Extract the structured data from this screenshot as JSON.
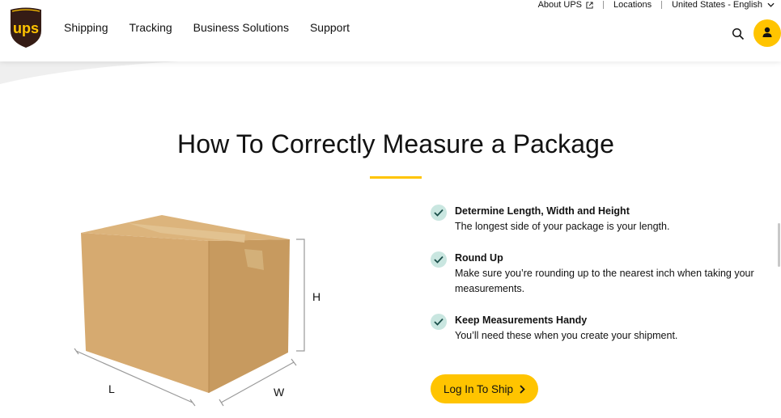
{
  "header": {
    "logo_text": "ups",
    "nav": [
      {
        "label": "Shipping"
      },
      {
        "label": "Tracking"
      },
      {
        "label": "Business Solutions"
      },
      {
        "label": "Support"
      }
    ],
    "utility": {
      "about": "About UPS",
      "locations": "Locations",
      "locale": "United States - English"
    },
    "icons": {
      "search": "search-icon",
      "account": "user-icon",
      "external": "external-link-icon",
      "locale_chevron": "chevron-down-icon"
    }
  },
  "main": {
    "title": "How To Correctly Measure a Package",
    "dimensions": {
      "h": "H",
      "l": "L",
      "w": "W"
    },
    "features": [
      {
        "title": "Determine Length, Width and Height",
        "desc": "The longest side of your package is your length."
      },
      {
        "title": "Round Up",
        "desc": "Make sure you’re rounding up to the nearest inch when taking your measurements."
      },
      {
        "title": "Keep Measurements Handy",
        "desc": "You’ll need these when you create your shipment."
      }
    ],
    "cta_label": "Log In To Ship"
  },
  "colors": {
    "brand_brown": "#351c15",
    "brand_gold": "#ffc400",
    "check_bg": "#c9e6e0",
    "check_mark": "#1b4f4a"
  }
}
